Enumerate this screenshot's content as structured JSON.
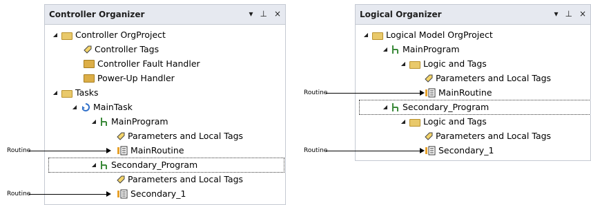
{
  "left_pane": {
    "title": "Controller Organizer",
    "items": [
      {
        "label": "Controller OrgProject"
      },
      {
        "label": "Controller Tags"
      },
      {
        "label": "Controller Fault Handler"
      },
      {
        "label": "Power-Up Handler"
      },
      {
        "label": "Tasks"
      },
      {
        "label": "MainTask"
      },
      {
        "label": "MainProgram"
      },
      {
        "label": "Parameters and Local Tags"
      },
      {
        "label": "MainRoutine"
      },
      {
        "label": "Secondary_Program"
      },
      {
        "label": "Parameters and Local Tags"
      },
      {
        "label": "Secondary_1"
      }
    ]
  },
  "right_pane": {
    "title": "Logical Organizer",
    "items": [
      {
        "label": "Logical Model OrgProject"
      },
      {
        "label": "MainProgram"
      },
      {
        "label": "Logic and Tags"
      },
      {
        "label": "Parameters and Local Tags"
      },
      {
        "label": "MainRoutine"
      },
      {
        "label": "Secondary_Program"
      },
      {
        "label": "Logic and Tags"
      },
      {
        "label": "Parameters and Local Tags"
      },
      {
        "label": "Secondary_1"
      }
    ]
  },
  "callouts": {
    "routine_label": "Routine"
  },
  "window_controls": {
    "dropdown": "▾",
    "pin": "⊥",
    "close": "×"
  },
  "colors": {
    "titlebar_bg": "#e6e9f0",
    "folder": "#e9c96b",
    "task_blue": "#2f6fc9",
    "program_green": "#3b8a3a"
  },
  "icons": [
    "folder-open-icon",
    "tag-icon",
    "folder-icon",
    "task-icon",
    "program-icon",
    "routine-icon",
    "expand-arrow-icon"
  ]
}
